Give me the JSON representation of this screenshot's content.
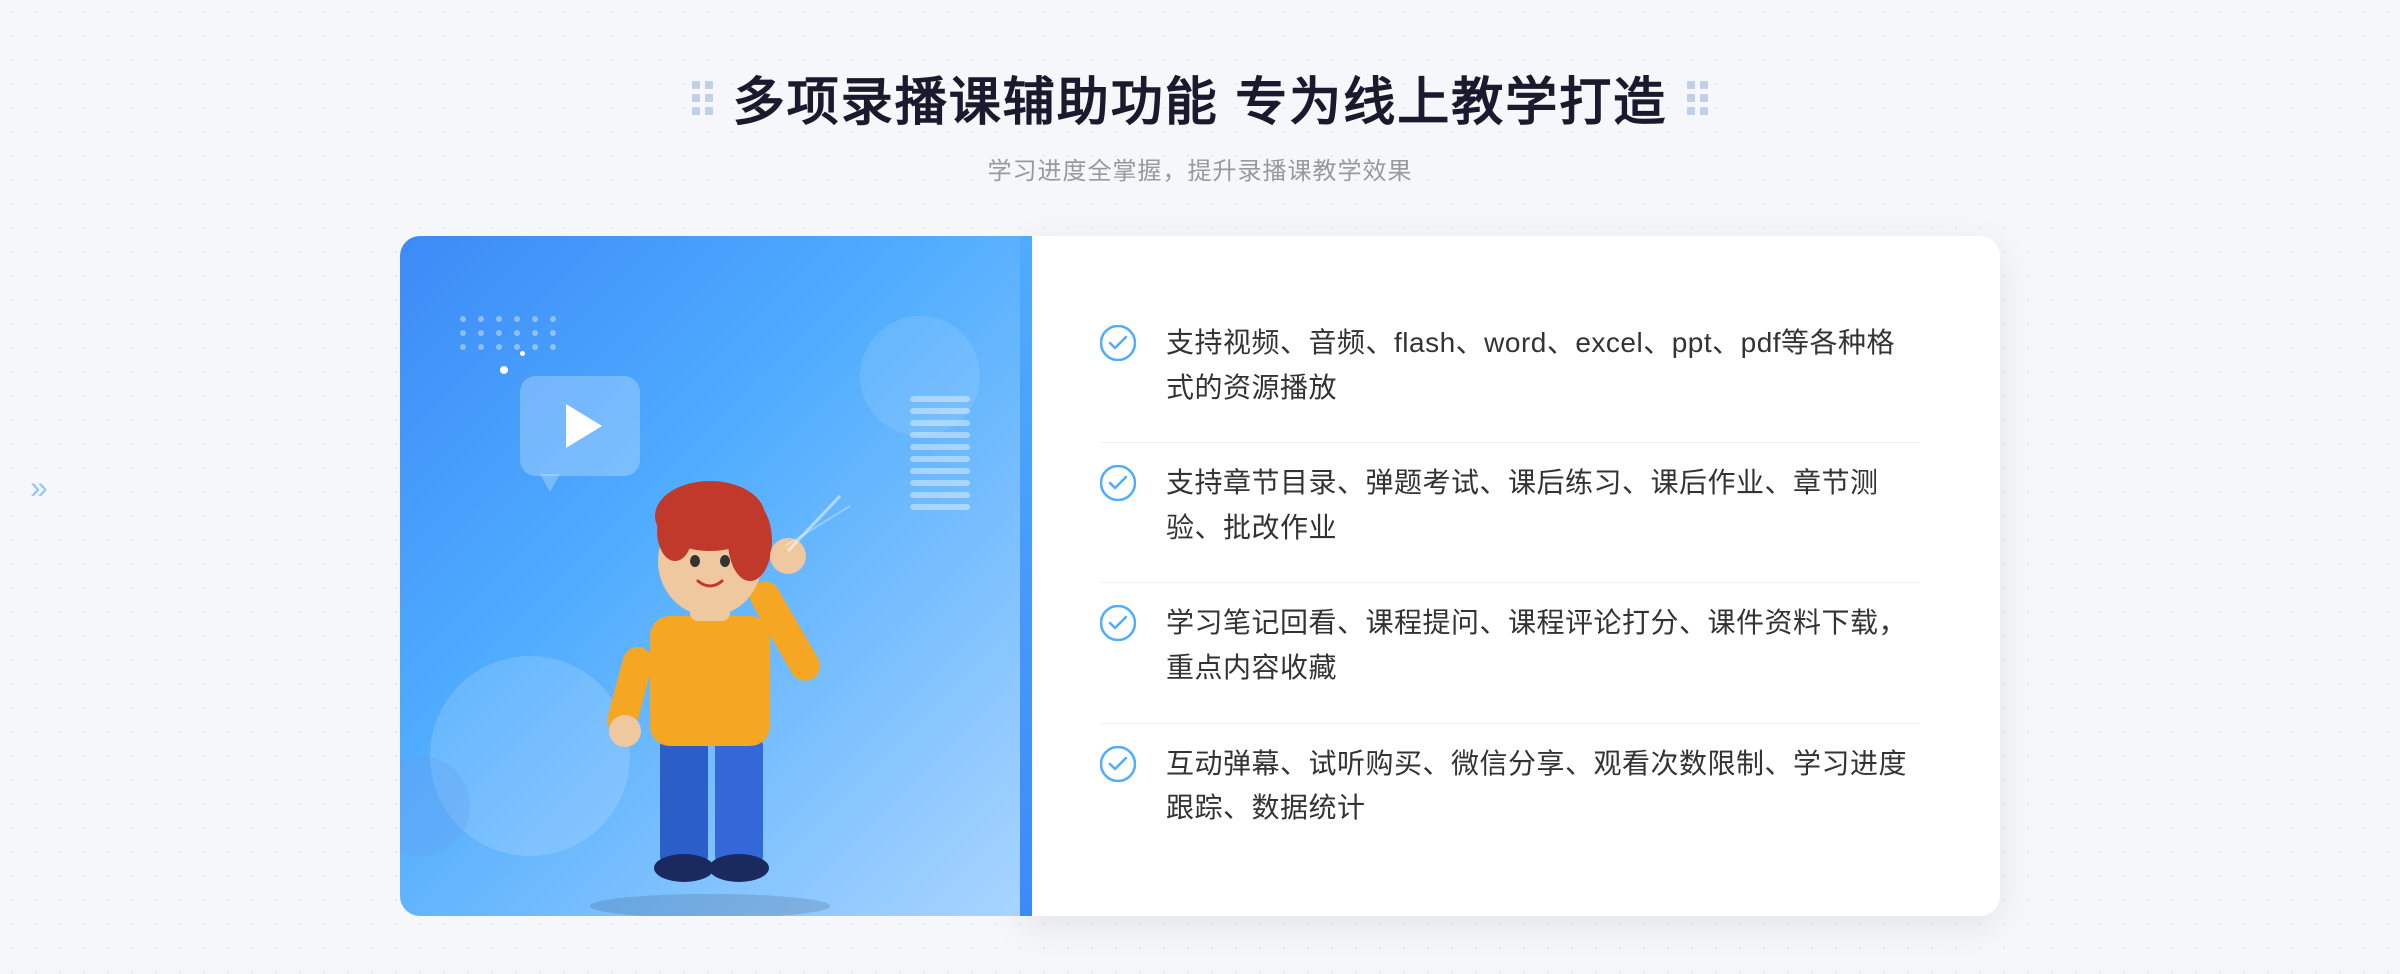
{
  "header": {
    "title": "多项录播课辅助功能 专为线上教学打造",
    "subtitle": "学习进度全掌握，提升录播课教学效果"
  },
  "features": [
    {
      "id": "feature-1",
      "text": "支持视频、音频、flash、word、excel、ppt、pdf等各种格式的资源播放"
    },
    {
      "id": "feature-2",
      "text": "支持章节目录、弹题考试、课后练习、课后作业、章节测验、批改作业"
    },
    {
      "id": "feature-3",
      "text": "学习笔记回看、课程提问、课程评论打分、课件资料下载，重点内容收藏"
    },
    {
      "id": "feature-4",
      "text": "互动弹幕、试听购买、微信分享、观看次数限制、学习进度跟踪、数据统计"
    }
  ],
  "decoration": {
    "left_arrow": "»",
    "check_color": "#4facfe"
  }
}
